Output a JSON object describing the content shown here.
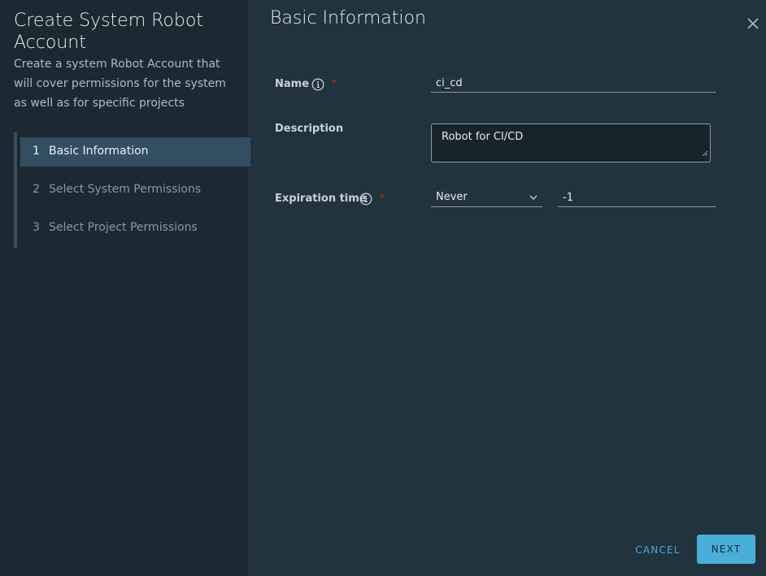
{
  "wizard": {
    "title": "Create System Robot Account",
    "description": "Create a system Robot Account that will cover permissions for the system as well as for specific projects",
    "steps": [
      {
        "number": "1",
        "label": "Basic Information"
      },
      {
        "number": "2",
        "label": "Select System Permissions"
      },
      {
        "number": "3",
        "label": "Select Project Permissions"
      }
    ]
  },
  "form": {
    "title": "Basic Information",
    "name_label": "Name",
    "name_value": "ci_cd",
    "description_label": "Description",
    "description_value": "Robot for CI/CD",
    "expiration_label": "Expiration time",
    "expiration_select": "Never",
    "expiration_days": "-1",
    "required_mark": "*"
  },
  "footer": {
    "cancel_label": "CANCEL",
    "next_label": "NEXT"
  },
  "colors": {
    "accent": "#49afd9",
    "required": "#e12200",
    "active_step": "#324f61"
  }
}
